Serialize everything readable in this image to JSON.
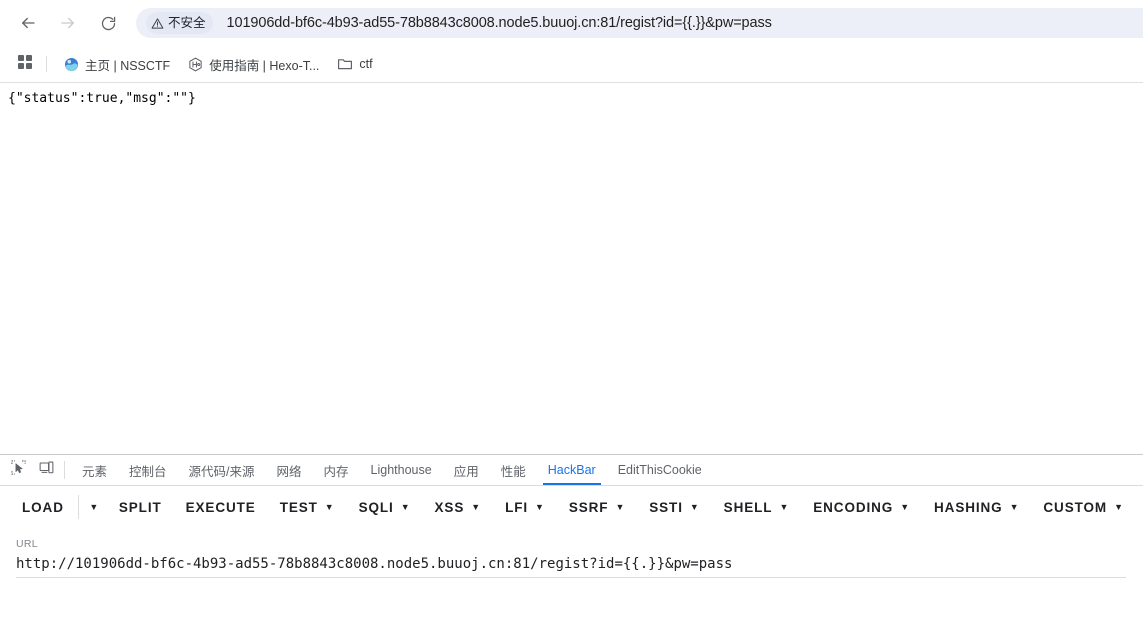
{
  "browser": {
    "nav": {
      "back_icon": "arrow-left-icon",
      "forward_icon": "arrow-right-icon",
      "reload_icon": "reload-icon"
    },
    "omnibox": {
      "security_chip_label": "不安全",
      "security_icon": "warning-triangle-icon",
      "url": "101906dd-bf6c-4b93-ad55-78b8843c8008.node5.buuoj.cn:81/regist?id={{.}}&pw=pass",
      "background_color": "#eceff8"
    },
    "bookmarks": {
      "apps_icon": "apps-grid-icon",
      "items": [
        {
          "label": "主页 | NSSCTF",
          "icon": "globe-favicon"
        },
        {
          "label": "使用指南 | Hexo-T...",
          "icon": "hexo-favicon"
        },
        {
          "label": "ctf",
          "icon": "folder-icon"
        }
      ]
    }
  },
  "page": {
    "body_text": "{\"status\":true,\"msg\":\"\"}"
  },
  "devtools": {
    "inspect_icon": "inspect-element-icon",
    "device_icon": "device-toolbar-icon",
    "active_tab": "HackBar",
    "accent_color": "#1a73e8",
    "tabs": [
      {
        "label": "元素"
      },
      {
        "label": "控制台"
      },
      {
        "label": "源代码/来源"
      },
      {
        "label": "网络"
      },
      {
        "label": "内存"
      },
      {
        "label": "Lighthouse"
      },
      {
        "label": "应用"
      },
      {
        "label": "性能"
      },
      {
        "label": "HackBar"
      },
      {
        "label": "EditThisCookie"
      }
    ]
  },
  "hackbar": {
    "toolbar": [
      {
        "label": "LOAD",
        "caret": false
      },
      {
        "label": "",
        "caret_only": true
      },
      {
        "label": "SPLIT",
        "caret": false
      },
      {
        "label": "EXECUTE",
        "caret": false
      },
      {
        "label": "TEST",
        "caret": true
      },
      {
        "label": "SQLI",
        "caret": true
      },
      {
        "label": "XSS",
        "caret": true
      },
      {
        "label": "LFI",
        "caret": true
      },
      {
        "label": "SSRF",
        "caret": true
      },
      {
        "label": "SSTI",
        "caret": true
      },
      {
        "label": "SHELL",
        "caret": true
      },
      {
        "label": "ENCODING",
        "caret": true
      },
      {
        "label": "HASHING",
        "caret": true
      },
      {
        "label": "CUSTOM",
        "caret": true
      }
    ],
    "url_field": {
      "label": "URL",
      "value": "http://101906dd-bf6c-4b93-ad55-78b8843c8008.node5.buuoj.cn:81/regist?id={{.}}&pw=pass",
      "placeholder": "URL"
    }
  }
}
